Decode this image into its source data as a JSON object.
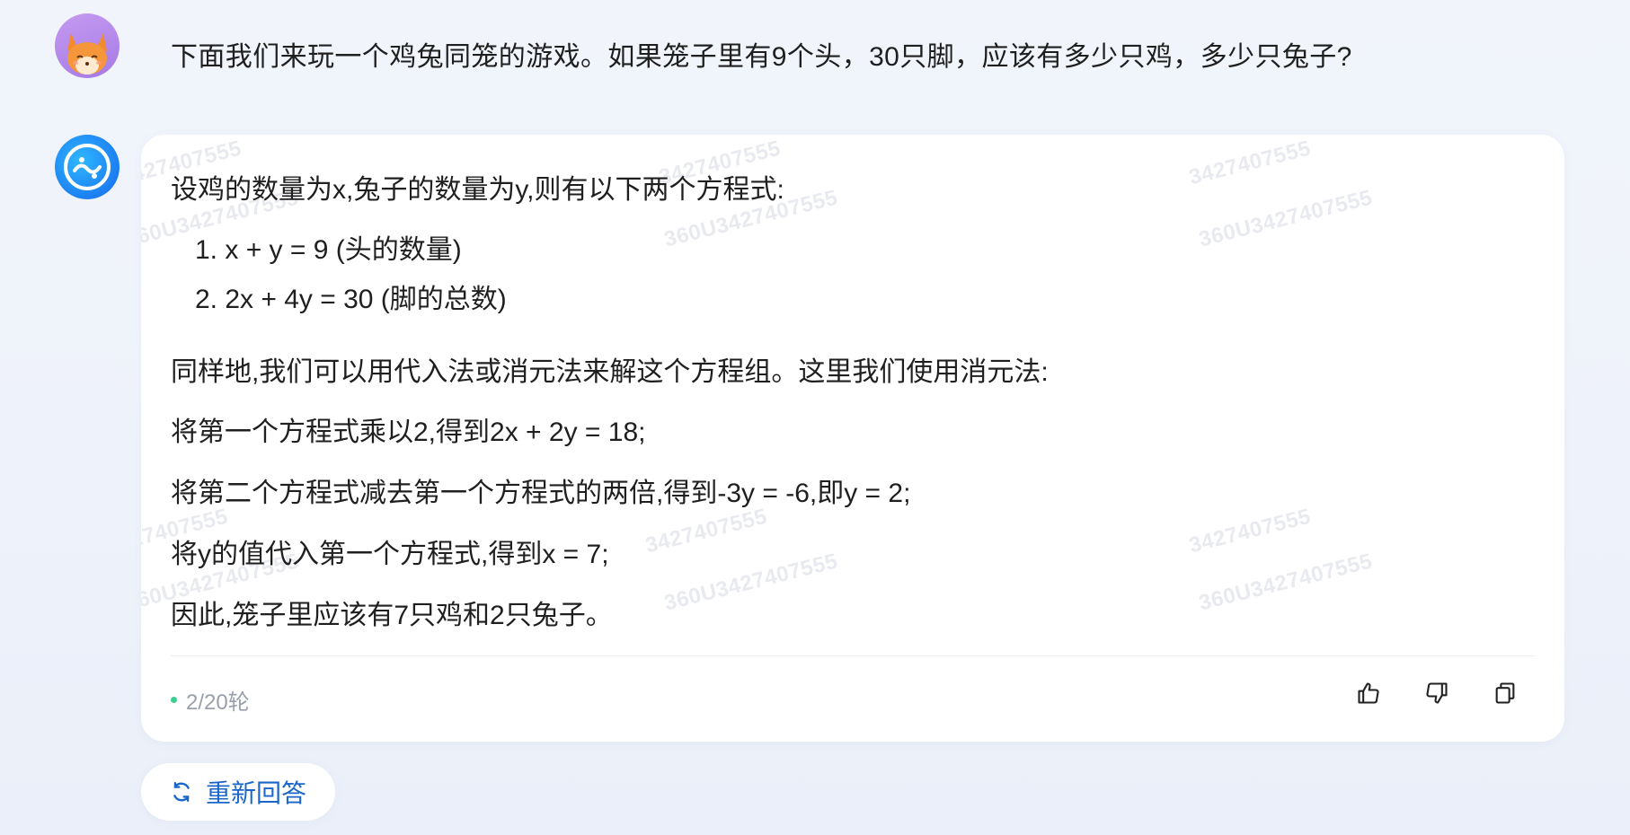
{
  "user": {
    "avatar_icon": "fox-avatar-icon",
    "message": "下面我们来玩一个鸡兔同笼的游戏。如果笼子里有9个头，30只脚，应该有多少只鸡，多少只兔子?"
  },
  "assistant": {
    "avatar_icon": "assistant-logo-icon",
    "intro": "设鸡的数量为x,兔子的数量为y,则有以下两个方程式:",
    "equations": [
      "1. x + y = 9 (头的数量)",
      "2. 2x + 4y = 30 (脚的总数)"
    ],
    "steps": [
      "同样地,我们可以用代入法或消元法来解这个方程组。这里我们使用消元法:",
      "将第一个方程式乘以2,得到2x + 2y = 18;",
      "将第二个方程式减去第一个方程式的两倍,得到-3y = -6,即y = 2;",
      "将y的值代入第一个方程式,得到x = 7;",
      "因此,笼子里应该有7只鸡和2只兔子。"
    ],
    "round_counter": "2/20轮",
    "actions": [
      {
        "icon": "thumbs-up-icon"
      },
      {
        "icon": "thumbs-down-icon"
      },
      {
        "icon": "copy-icon"
      }
    ]
  },
  "watermarks": [
    "3427407555",
    "360U3427407555"
  ],
  "regenerate_label": "重新回答",
  "colors": {
    "accent": "#1a66c9",
    "status_dot": "#3fce8f",
    "background": "#eef2fa"
  }
}
